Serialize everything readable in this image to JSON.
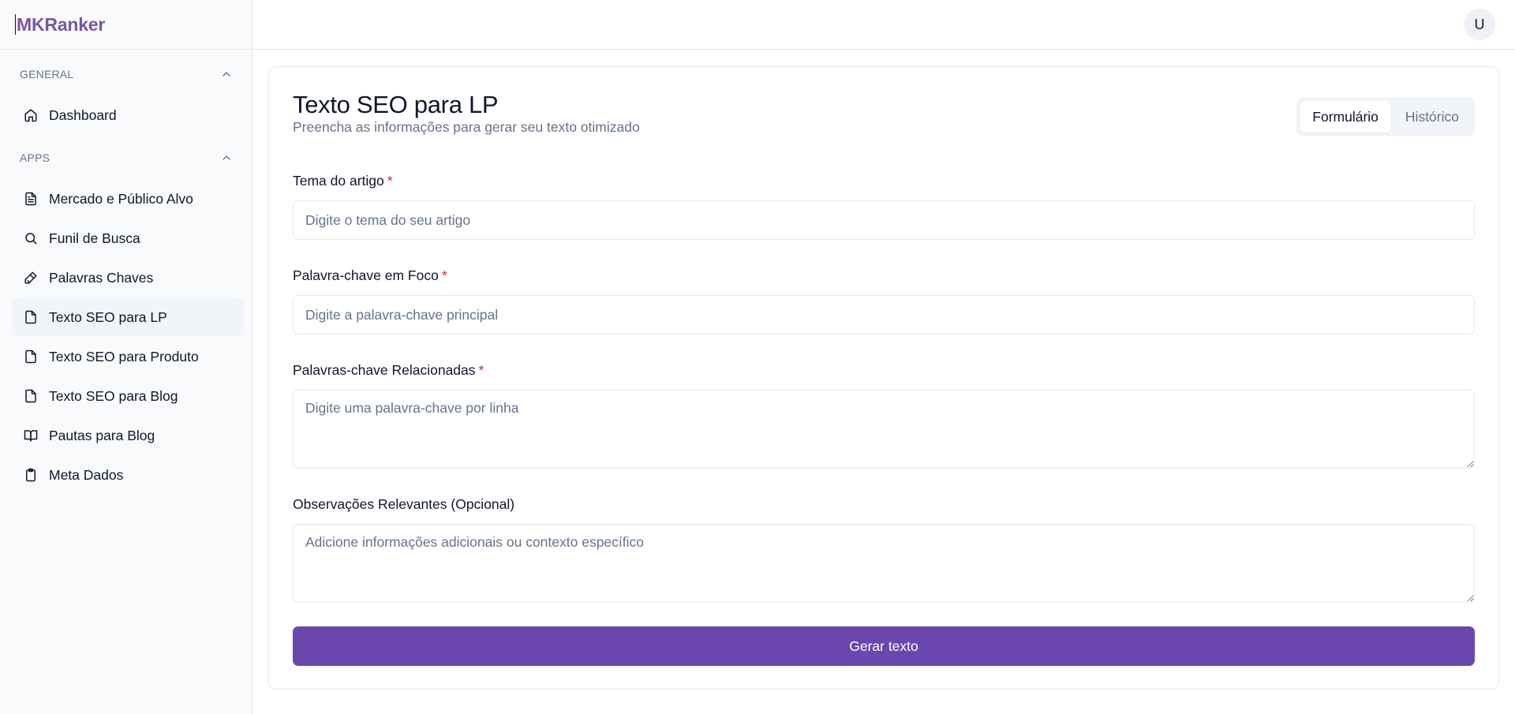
{
  "brand": {
    "name": "MKRanker"
  },
  "topbar": {
    "avatar_initial": "U"
  },
  "sidebar": {
    "general_label": "GENERAL",
    "apps_label": "APPS",
    "general_items": [
      {
        "label": "Dashboard",
        "icon": "home-icon"
      }
    ],
    "apps_items": [
      {
        "label": "Mercado e Público Alvo",
        "icon": "document-text-icon"
      },
      {
        "label": "Funil de Busca",
        "icon": "search-icon"
      },
      {
        "label": "Palavras Chaves",
        "icon": "key-icon"
      },
      {
        "label": "Texto SEO para LP",
        "icon": "file-icon",
        "active": true
      },
      {
        "label": "Texto SEO para Produto",
        "icon": "file-icon"
      },
      {
        "label": "Texto SEO para Blog",
        "icon": "file-icon"
      },
      {
        "label": "Pautas para Blog",
        "icon": "book-open-icon"
      },
      {
        "label": "Meta Dados",
        "icon": "clipboard-icon"
      }
    ]
  },
  "main": {
    "title": "Texto SEO para LP",
    "subtitle": "Preencha as informações para gerar seu texto otimizado",
    "tabs": [
      {
        "label": "Formulário",
        "active": true
      },
      {
        "label": "Histórico",
        "active": false
      }
    ],
    "fields": {
      "tema": {
        "label": "Tema do artigo",
        "required_mark": "*",
        "placeholder": "Digite o tema do seu artigo",
        "value": ""
      },
      "foco": {
        "label": "Palavra-chave em Foco",
        "required_mark": "*",
        "placeholder": "Digite a palavra-chave principal",
        "value": ""
      },
      "relacionadas": {
        "label": "Palavras-chave Relacionadas",
        "required_mark": "*",
        "placeholder": "Digite uma palavra-chave por linha",
        "value": ""
      },
      "observacoes": {
        "label": "Observações Relevantes (Opcional)",
        "placeholder": "Adicione informações adicionais ou contexto específico",
        "value": ""
      }
    },
    "submit_label": "Gerar texto"
  },
  "colors": {
    "brand": "#7b55a5",
    "primary_button": "#6b46ad",
    "required": "#dc2626",
    "muted_text": "#64748b",
    "active_nav_bg": "#f1f5f9"
  }
}
